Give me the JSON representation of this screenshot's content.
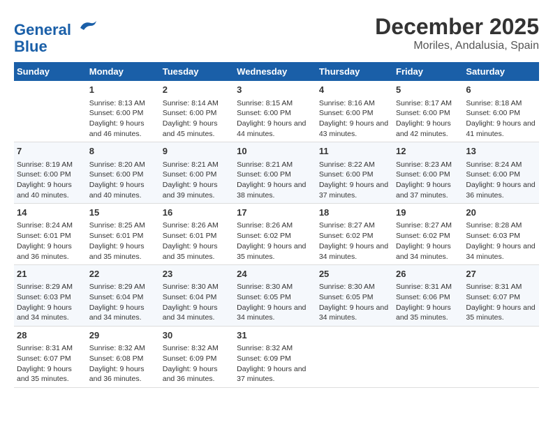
{
  "header": {
    "logo_line1": "General",
    "logo_line2": "Blue",
    "month": "December 2025",
    "location": "Moriles, Andalusia, Spain"
  },
  "weekdays": [
    "Sunday",
    "Monday",
    "Tuesday",
    "Wednesday",
    "Thursday",
    "Friday",
    "Saturday"
  ],
  "weeks": [
    [
      {
        "day": "",
        "sunrise": "",
        "sunset": "",
        "daylight": ""
      },
      {
        "day": "1",
        "sunrise": "Sunrise: 8:13 AM",
        "sunset": "Sunset: 6:00 PM",
        "daylight": "Daylight: 9 hours and 46 minutes."
      },
      {
        "day": "2",
        "sunrise": "Sunrise: 8:14 AM",
        "sunset": "Sunset: 6:00 PM",
        "daylight": "Daylight: 9 hours and 45 minutes."
      },
      {
        "day": "3",
        "sunrise": "Sunrise: 8:15 AM",
        "sunset": "Sunset: 6:00 PM",
        "daylight": "Daylight: 9 hours and 44 minutes."
      },
      {
        "day": "4",
        "sunrise": "Sunrise: 8:16 AM",
        "sunset": "Sunset: 6:00 PM",
        "daylight": "Daylight: 9 hours and 43 minutes."
      },
      {
        "day": "5",
        "sunrise": "Sunrise: 8:17 AM",
        "sunset": "Sunset: 6:00 PM",
        "daylight": "Daylight: 9 hours and 42 minutes."
      },
      {
        "day": "6",
        "sunrise": "Sunrise: 8:18 AM",
        "sunset": "Sunset: 6:00 PM",
        "daylight": "Daylight: 9 hours and 41 minutes."
      }
    ],
    [
      {
        "day": "7",
        "sunrise": "Sunrise: 8:19 AM",
        "sunset": "Sunset: 6:00 PM",
        "daylight": "Daylight: 9 hours and 40 minutes."
      },
      {
        "day": "8",
        "sunrise": "Sunrise: 8:20 AM",
        "sunset": "Sunset: 6:00 PM",
        "daylight": "Daylight: 9 hours and 40 minutes."
      },
      {
        "day": "9",
        "sunrise": "Sunrise: 8:21 AM",
        "sunset": "Sunset: 6:00 PM",
        "daylight": "Daylight: 9 hours and 39 minutes."
      },
      {
        "day": "10",
        "sunrise": "Sunrise: 8:21 AM",
        "sunset": "Sunset: 6:00 PM",
        "daylight": "Daylight: 9 hours and 38 minutes."
      },
      {
        "day": "11",
        "sunrise": "Sunrise: 8:22 AM",
        "sunset": "Sunset: 6:00 PM",
        "daylight": "Daylight: 9 hours and 37 minutes."
      },
      {
        "day": "12",
        "sunrise": "Sunrise: 8:23 AM",
        "sunset": "Sunset: 6:00 PM",
        "daylight": "Daylight: 9 hours and 37 minutes."
      },
      {
        "day": "13",
        "sunrise": "Sunrise: 8:24 AM",
        "sunset": "Sunset: 6:00 PM",
        "daylight": "Daylight: 9 hours and 36 minutes."
      }
    ],
    [
      {
        "day": "14",
        "sunrise": "Sunrise: 8:24 AM",
        "sunset": "Sunset: 6:01 PM",
        "daylight": "Daylight: 9 hours and 36 minutes."
      },
      {
        "day": "15",
        "sunrise": "Sunrise: 8:25 AM",
        "sunset": "Sunset: 6:01 PM",
        "daylight": "Daylight: 9 hours and 35 minutes."
      },
      {
        "day": "16",
        "sunrise": "Sunrise: 8:26 AM",
        "sunset": "Sunset: 6:01 PM",
        "daylight": "Daylight: 9 hours and 35 minutes."
      },
      {
        "day": "17",
        "sunrise": "Sunrise: 8:26 AM",
        "sunset": "Sunset: 6:02 PM",
        "daylight": "Daylight: 9 hours and 35 minutes."
      },
      {
        "day": "18",
        "sunrise": "Sunrise: 8:27 AM",
        "sunset": "Sunset: 6:02 PM",
        "daylight": "Daylight: 9 hours and 34 minutes."
      },
      {
        "day": "19",
        "sunrise": "Sunrise: 8:27 AM",
        "sunset": "Sunset: 6:02 PM",
        "daylight": "Daylight: 9 hours and 34 minutes."
      },
      {
        "day": "20",
        "sunrise": "Sunrise: 8:28 AM",
        "sunset": "Sunset: 6:03 PM",
        "daylight": "Daylight: 9 hours and 34 minutes."
      }
    ],
    [
      {
        "day": "21",
        "sunrise": "Sunrise: 8:29 AM",
        "sunset": "Sunset: 6:03 PM",
        "daylight": "Daylight: 9 hours and 34 minutes."
      },
      {
        "day": "22",
        "sunrise": "Sunrise: 8:29 AM",
        "sunset": "Sunset: 6:04 PM",
        "daylight": "Daylight: 9 hours and 34 minutes."
      },
      {
        "day": "23",
        "sunrise": "Sunrise: 8:30 AM",
        "sunset": "Sunset: 6:04 PM",
        "daylight": "Daylight: 9 hours and 34 minutes."
      },
      {
        "day": "24",
        "sunrise": "Sunrise: 8:30 AM",
        "sunset": "Sunset: 6:05 PM",
        "daylight": "Daylight: 9 hours and 34 minutes."
      },
      {
        "day": "25",
        "sunrise": "Sunrise: 8:30 AM",
        "sunset": "Sunset: 6:05 PM",
        "daylight": "Daylight: 9 hours and 34 minutes."
      },
      {
        "day": "26",
        "sunrise": "Sunrise: 8:31 AM",
        "sunset": "Sunset: 6:06 PM",
        "daylight": "Daylight: 9 hours and 35 minutes."
      },
      {
        "day": "27",
        "sunrise": "Sunrise: 8:31 AM",
        "sunset": "Sunset: 6:07 PM",
        "daylight": "Daylight: 9 hours and 35 minutes."
      }
    ],
    [
      {
        "day": "28",
        "sunrise": "Sunrise: 8:31 AM",
        "sunset": "Sunset: 6:07 PM",
        "daylight": "Daylight: 9 hours and 35 minutes."
      },
      {
        "day": "29",
        "sunrise": "Sunrise: 8:32 AM",
        "sunset": "Sunset: 6:08 PM",
        "daylight": "Daylight: 9 hours and 36 minutes."
      },
      {
        "day": "30",
        "sunrise": "Sunrise: 8:32 AM",
        "sunset": "Sunset: 6:09 PM",
        "daylight": "Daylight: 9 hours and 36 minutes."
      },
      {
        "day": "31",
        "sunrise": "Sunrise: 8:32 AM",
        "sunset": "Sunset: 6:09 PM",
        "daylight": "Daylight: 9 hours and 37 minutes."
      },
      {
        "day": "",
        "sunrise": "",
        "sunset": "",
        "daylight": ""
      },
      {
        "day": "",
        "sunrise": "",
        "sunset": "",
        "daylight": ""
      },
      {
        "day": "",
        "sunrise": "",
        "sunset": "",
        "daylight": ""
      }
    ]
  ]
}
